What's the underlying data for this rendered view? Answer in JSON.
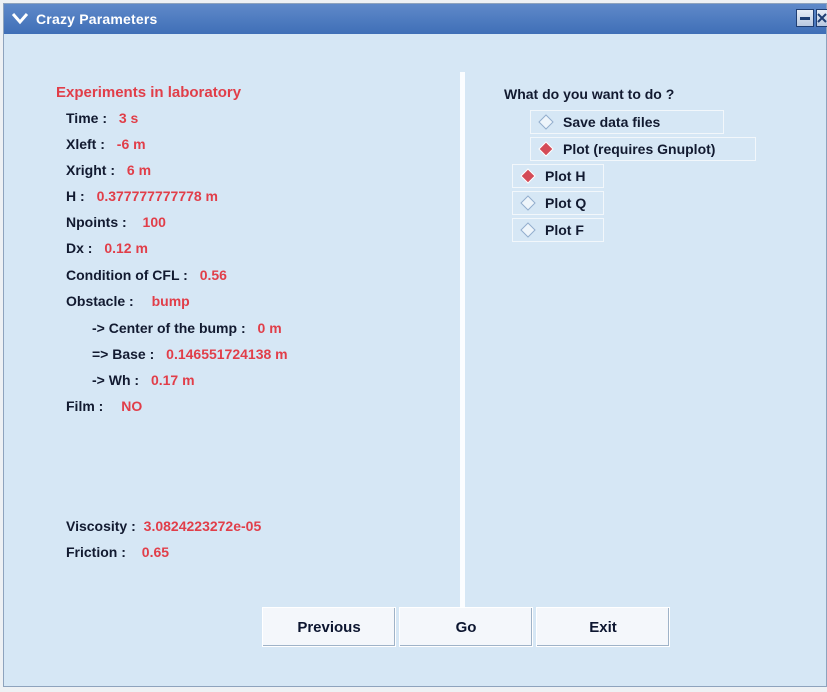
{
  "window": {
    "title": "Crazy Parameters"
  },
  "left": {
    "section_title": "Experiments in laboratory",
    "rows": [
      {
        "label": "Time :",
        "value": "3 s"
      },
      {
        "label": "Xleft :",
        "value": "-6 m"
      },
      {
        "label": "Xright :",
        "value": "6 m"
      },
      {
        "label": "H :",
        "value": "0.377777777778 m"
      },
      {
        "label": "Npoints :",
        "value": "100"
      },
      {
        "label": "Dx :",
        "value": "0.12 m"
      },
      {
        "label": "Condition of CFL :",
        "value": "0.56"
      },
      {
        "label": "Obstacle :",
        "value": "bump"
      },
      {
        "label": "-> Center of the bump :",
        "value": "0 m"
      },
      {
        "label": "=> Base :",
        "value": "0.146551724138 m"
      },
      {
        "label": "-> Wh :",
        "value": "0.17 m"
      },
      {
        "label": "Film :",
        "value": "NO"
      }
    ],
    "viscosity": {
      "label": "Viscosity :",
      "value": "3.0824223272e-05"
    },
    "friction": {
      "label": "Friction :",
      "value": "0.65"
    }
  },
  "right": {
    "question": "What do you want to do ?",
    "choices": [
      {
        "label": "Save data files",
        "selected": false
      },
      {
        "label": "Plot (requires Gnuplot)",
        "selected": true
      }
    ],
    "plot_options": [
      {
        "label": "Plot H",
        "selected": true
      },
      {
        "label": "Plot Q",
        "selected": false
      },
      {
        "label": "Plot F",
        "selected": false
      }
    ]
  },
  "buttons": {
    "previous": "Previous",
    "go": "Go",
    "exit": "Exit"
  },
  "colors": {
    "background": "#d6e7f5",
    "value_red": "#e13e49",
    "label_dark": "#121a30",
    "titlebar_blue": "#3f6fb7"
  }
}
